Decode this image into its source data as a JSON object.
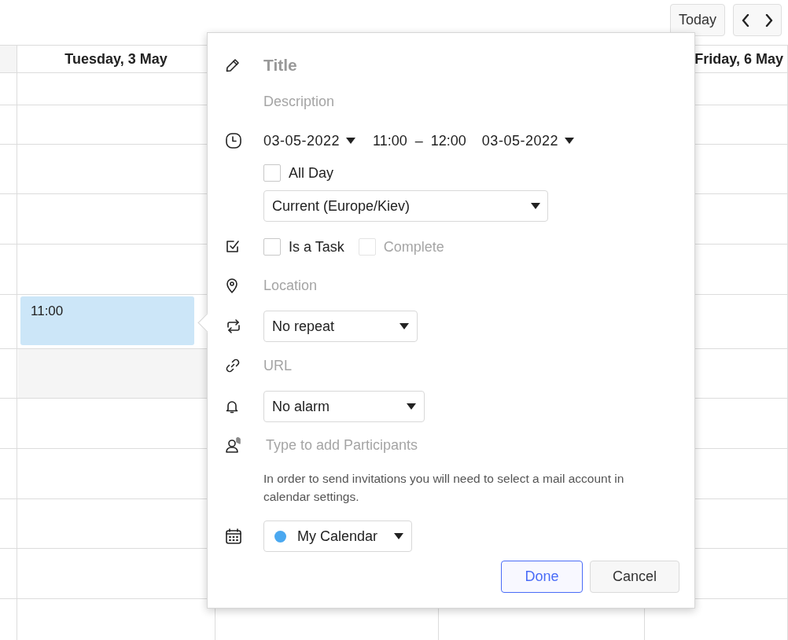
{
  "toolbar": {
    "today_button": "Today"
  },
  "calendar": {
    "day_headers": [
      "Tuesday, 3 May",
      "Friday, 6 May"
    ],
    "event": {
      "time": "11:00"
    }
  },
  "event_editor": {
    "title": {
      "placeholder": "Title"
    },
    "description": {
      "placeholder": "Description"
    },
    "start_date": "03-05-2022",
    "start_time": "11:00",
    "time_separator": "–",
    "end_time": "12:00",
    "end_date": "03-05-2022",
    "all_day": {
      "label": "All Day",
      "checked": false
    },
    "timezone": "Current (Europe/Kiev)",
    "is_task": {
      "label": "Is a Task",
      "checked": false
    },
    "complete": {
      "label": "Complete",
      "checked": false,
      "disabled": true
    },
    "location": {
      "placeholder": "Location"
    },
    "repeat": "No repeat",
    "url": {
      "placeholder": "URL"
    },
    "alarm": "No alarm",
    "participants": {
      "placeholder": "Type to add Participants"
    },
    "notice": "In order to send invitations you will need to select a mail account in calendar settings.",
    "calendar": {
      "name": "My Calendar",
      "color": "#4aa8f0"
    },
    "buttons": [
      {
        "label": "Done",
        "kind": "primary"
      },
      {
        "label": "Cancel",
        "kind": "secondary"
      }
    ]
  }
}
